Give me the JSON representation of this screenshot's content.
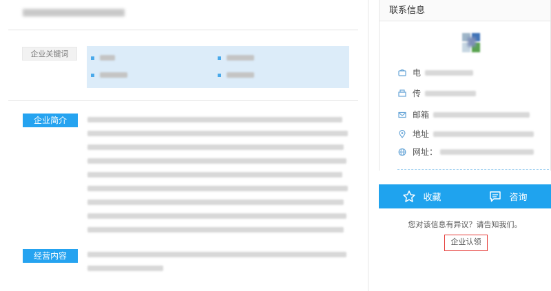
{
  "keywords": {
    "label": "企业关键词"
  },
  "sections": {
    "intro_label": "企业简介",
    "scope_label": "经营内容"
  },
  "contact": {
    "title": "联系信息",
    "rows": [
      {
        "icon": "phone-icon",
        "label": "电"
      },
      {
        "icon": "fax-icon",
        "label": "传"
      },
      {
        "icon": "mail-icon",
        "label": "邮箱"
      },
      {
        "icon": "location-icon",
        "label": "地址"
      },
      {
        "icon": "globe-icon",
        "label": "网址："
      }
    ]
  },
  "actions": {
    "favorite": "收藏",
    "consult": "咨询"
  },
  "feedback_text": "您对该信息有异议？请告知我们。",
  "claim_label": "企业认领",
  "colors": {
    "accent": "#1fa3ee",
    "label_blue": "#25a3f0",
    "keyword_bg": "#dcecf9",
    "claim_border": "#e53935"
  }
}
